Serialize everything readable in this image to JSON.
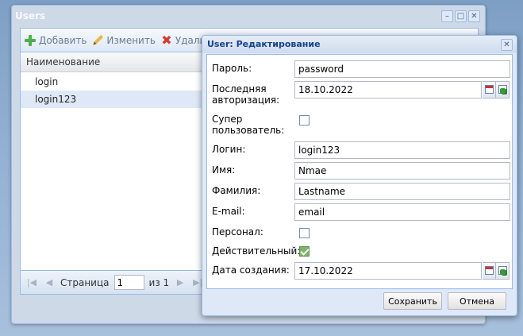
{
  "users_window": {
    "title": "Users",
    "toolbar": {
      "add_label": "Добавить",
      "edit_label": "Изменить",
      "delete_label": "Удалить"
    },
    "grid": {
      "column_header": "Наименование",
      "rows": [
        "login",
        "login123"
      ],
      "selected_row": "login123"
    },
    "pager": {
      "page_label": "Страница",
      "page_value": "1",
      "of_label": "из 1"
    }
  },
  "edit_window": {
    "title": "User: Редактирование",
    "fields": {
      "password": {
        "label": "Пароль:",
        "value": "password"
      },
      "last_login": {
        "label": "Последняя авторизация:",
        "value": "18.10.2022"
      },
      "superuser": {
        "label": "Супер пользователь:",
        "checked": false
      },
      "login": {
        "label": "Логин:",
        "value": "login123"
      },
      "first_name": {
        "label": "Имя:",
        "value": "Nmae"
      },
      "last_name": {
        "label": "Фамилия:",
        "value": "Lastname"
      },
      "email": {
        "label": "E-mail:",
        "value": "email"
      },
      "staff": {
        "label": "Персонал:",
        "checked": false
      },
      "active": {
        "label": "Действительный:",
        "checked": true
      },
      "date_created": {
        "label": "Дата создания:",
        "value": "17.10.2022"
      }
    },
    "buttons": {
      "save": "Сохранить",
      "cancel": "Отмена"
    }
  },
  "colors": {
    "window_border": "#99bbe8",
    "title_text": "#15428b",
    "selected_row": "#dfe8f6",
    "checkbox_checked": "#7fb36a"
  },
  "icons": [
    "plus-icon",
    "pencil-icon",
    "delete-icon",
    "refresh-icon",
    "minimize-icon",
    "maximize-icon",
    "close-icon",
    "calendar-icon",
    "clear-date-icon",
    "first-page-icon",
    "prev-page-icon",
    "next-page-icon",
    "last-page-icon"
  ]
}
